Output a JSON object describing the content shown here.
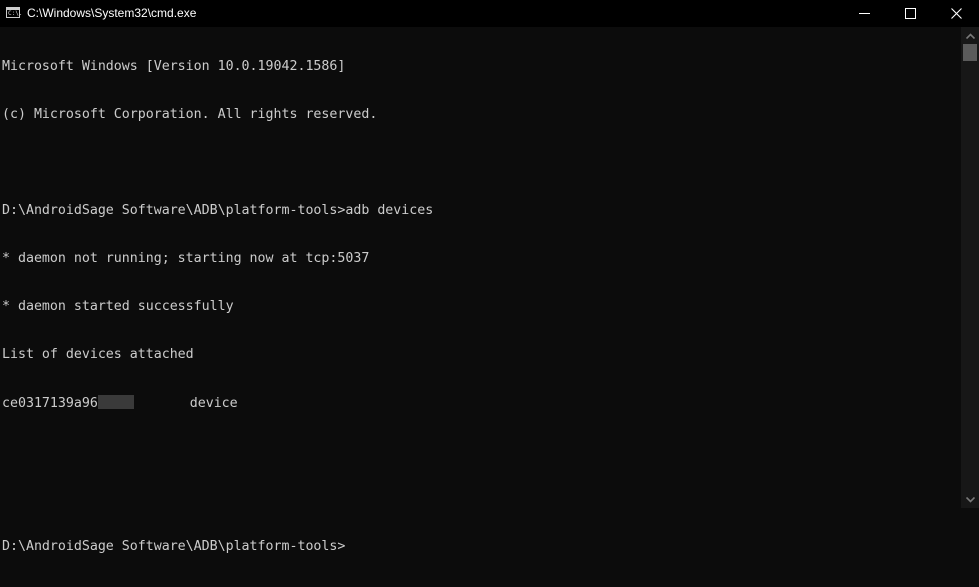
{
  "window": {
    "title": "C:\\Windows\\System32\\cmd.exe",
    "icon": "cmd-icon",
    "icon_text": "C:\\.",
    "controls": [
      "minimize",
      "maximize",
      "close"
    ]
  },
  "console": {
    "lines": [
      "Microsoft Windows [Version 10.0.19042.1586]",
      "(c) Microsoft Corporation. All rights reserved.",
      "",
      "D:\\AndroidSage Software\\ADB\\platform-tools>adb devices",
      "* daemon not running; starting now at tcp:5037",
      "* daemon started successfully",
      "List of devices attached"
    ],
    "device_row": {
      "serial_visible": "ce0317139a96",
      "serial_redacted": true,
      "state": "device"
    },
    "trailing_lines": [
      "",
      "",
      "D:\\AndroidSage Software\\ADB\\platform-tools>"
    ],
    "colors": {
      "background": "#0c0c0c",
      "foreground": "#cccccc",
      "titlebar": "#000000"
    }
  },
  "scrollbar": {
    "position": 0
  }
}
